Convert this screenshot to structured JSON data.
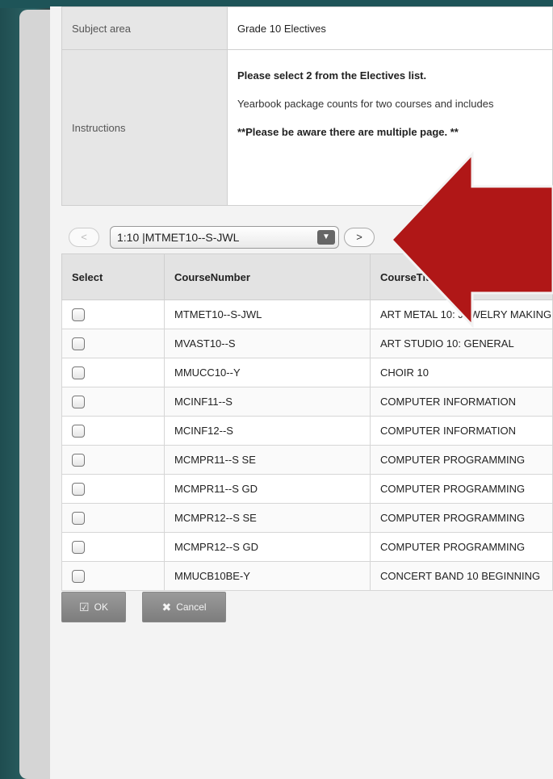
{
  "info": {
    "subject_label": "Subject area",
    "subject_value": "Grade 10 Electives",
    "instructions_label": "Instructions",
    "line1": "Please select 2 from the Electives list.",
    "line2": "Yearbook package counts for two courses and includes",
    "line3": "**Please be aware there are multiple page. **"
  },
  "pager": {
    "prev": "<",
    "selected": "1:10 |MTMET10--S-JWL",
    "next": ">"
  },
  "table": {
    "headers": [
      "Select",
      "CourseNumber",
      "CourseTitle"
    ],
    "rows": [
      {
        "number": "MTMET10--S-JWL",
        "title": "ART METAL 10: JEWELRY MAKING"
      },
      {
        "number": "MVAST10--S",
        "title": "ART STUDIO 10: GENERAL"
      },
      {
        "number": "MMUCC10--Y",
        "title": "CHOIR 10"
      },
      {
        "number": "MCINF11--S",
        "title": "COMPUTER INFORMATION"
      },
      {
        "number": "MCINF12--S",
        "title": "COMPUTER INFORMATION"
      },
      {
        "number": "MCMPR11--S SE",
        "title": "COMPUTER PROGRAMMING"
      },
      {
        "number": "MCMPR11--S GD",
        "title": "COMPUTER PROGRAMMING"
      },
      {
        "number": "MCMPR12--S SE",
        "title": "COMPUTER PROGRAMMING"
      },
      {
        "number": "MCMPR12--S GD",
        "title": "COMPUTER PROGRAMMING"
      },
      {
        "number": "MMUCB10BE-Y",
        "title": "CONCERT BAND 10 BEGINNING"
      }
    ]
  },
  "buttons": {
    "ok": "OK",
    "cancel": "Cancel"
  },
  "icons": {
    "ok": "check-square-icon",
    "cancel": "x-icon",
    "overlay": "red-arrow-left-icon"
  },
  "colors": {
    "arrow": "#b01717",
    "button_bg": "#8a8a8a",
    "header_bg": "#e3e3e3"
  }
}
